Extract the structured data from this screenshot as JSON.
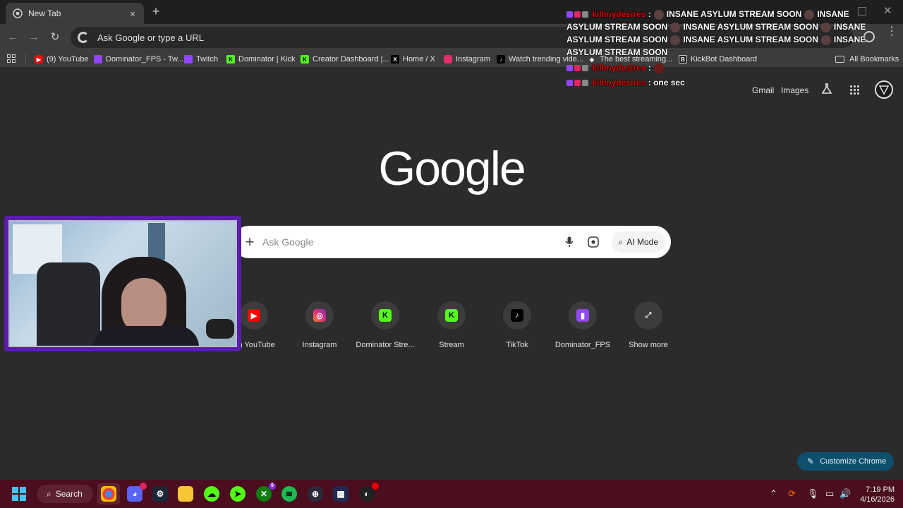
{
  "browser": {
    "tab_title": "New Tab",
    "tab_close": "×",
    "new_tab": "+",
    "omnibox_placeholder": "Ask Google or type a URL"
  },
  "bookmarks": [
    {
      "label": "(9) YouTube",
      "icon": "youtube-icon",
      "color": "#ff0000"
    },
    {
      "label": "Dominator_FPS - Tw...",
      "icon": "twitch-icon",
      "color": "#9146ff"
    },
    {
      "label": "Twitch",
      "icon": "twitch-icon",
      "color": "#9146ff"
    },
    {
      "label": "Dominator | Kick",
      "icon": "kick-icon",
      "color": "#53fc18"
    },
    {
      "label": "Creator Dashboard |...",
      "icon": "kick-icon",
      "color": "#53fc18"
    },
    {
      "label": "Home / X",
      "icon": "x-icon",
      "color": "#000000"
    },
    {
      "label": "Instagram",
      "icon": "instagram-icon",
      "color": "#e1306c"
    },
    {
      "label": "Watch trending vide...",
      "icon": "tiktok-icon",
      "color": "#000000"
    },
    {
      "label": "The best streaming...",
      "icon": "streaming-icon",
      "color": "#3c3c3c"
    },
    {
      "label": "KickBot Dashboard",
      "icon": "kickbot-icon",
      "color": "#222222"
    }
  ],
  "all_bookmarks": "All Bookmarks",
  "header_links": {
    "gmail": "Gmail",
    "images": "Images"
  },
  "logo": "Google",
  "search": {
    "placeholder": "Ask Google",
    "ai_mode": "AI Mode"
  },
  "shortcuts": [
    {
      "label": "(9) YouTube",
      "icon": "youtube-icon",
      "color": "#ff0000"
    },
    {
      "label": "Instagram",
      "icon": "instagram-icon",
      "color": "#e1306c"
    },
    {
      "label": "Dominator Stre...",
      "icon": "kick-icon",
      "color": "#53fc18"
    },
    {
      "label": "Stream",
      "icon": "kick-icon",
      "color": "#53fc18"
    },
    {
      "label": "TikTok",
      "icon": "tiktok-icon",
      "color": "#000000"
    },
    {
      "label": "Dominator_FPS",
      "icon": "twitch-icon",
      "color": "#9146ff"
    },
    {
      "label": "Show more",
      "icon": "expand-icon",
      "color": "#3c3c3c"
    }
  ],
  "chat": {
    "username": "killmydesires",
    "message_1": "INSANE ASYLUM STREAM SOON",
    "message_2": "one sec"
  },
  "customize": "Customize Chrome",
  "taskbar": {
    "search": "Search",
    "time": "7:19 PM",
    "date": "4/16/2026",
    "badge_chrome": "",
    "badge_xbox": "9"
  },
  "colors": {
    "accent": "#0e4f6c",
    "taskbar": "#4a0e1f",
    "webcam_frame": "#5a1ea8"
  }
}
